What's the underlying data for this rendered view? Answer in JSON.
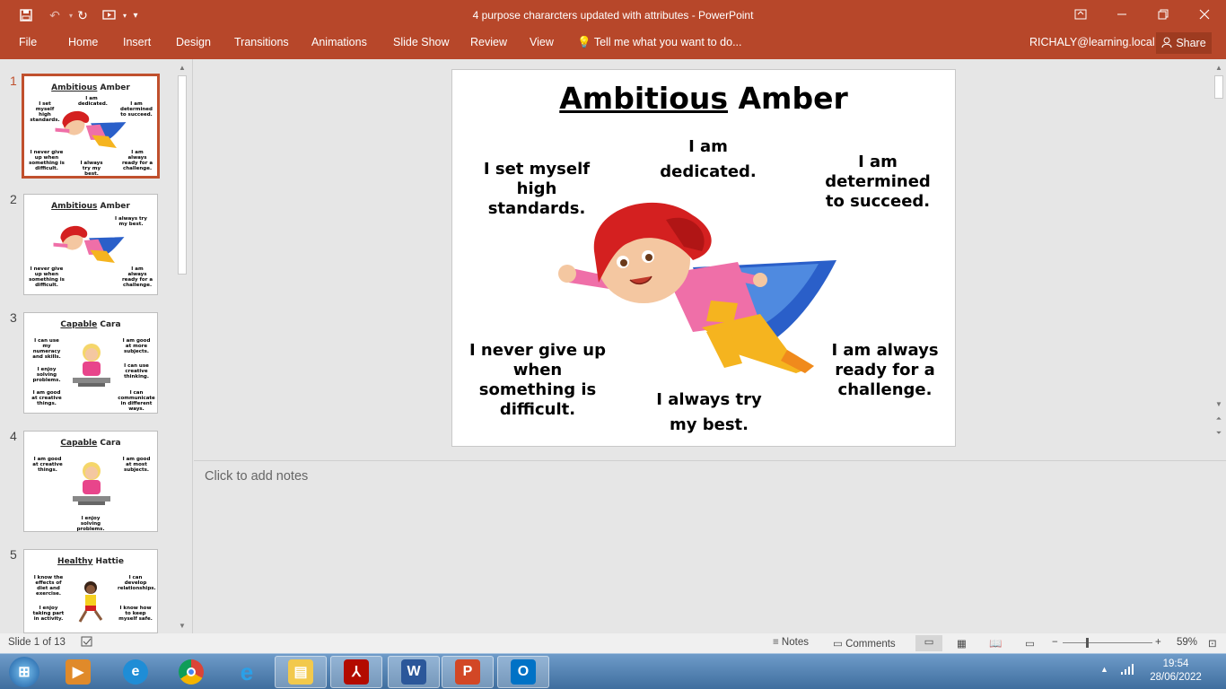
{
  "app": {
    "title": "4 purpose chararcters updated with attributes - PowerPoint",
    "user": "RICHALY@learning.local",
    "share_label": "Share",
    "accent": "#b7472a"
  },
  "ribbon": {
    "tabs": [
      "File",
      "Home",
      "Insert",
      "Design",
      "Transitions",
      "Animations",
      "Slide Show",
      "Review",
      "View"
    ],
    "tell_me": "Tell me what you want to do..."
  },
  "thumbnails": [
    {
      "number": "1",
      "title_u": "Ambitious",
      "title_rest": "Amber",
      "texts": [
        "I set myself high standards.",
        "I am dedicated.",
        "I am determined to succeed.",
        "I never give up when something is difficult.",
        "I always try my best.",
        "I am always ready for a challenge."
      ]
    },
    {
      "number": "2",
      "title_u": "Ambitious",
      "title_rest": "Amber",
      "texts": [
        "I always try my best.",
        "I never give up when something is difficult.",
        "I am always ready for a challenge."
      ]
    },
    {
      "number": "3",
      "title_u": "Capable",
      "title_rest": "Cara",
      "texts": [
        "I can use my numeracy and skills.",
        "I am good at more subjects.",
        "I enjoy solving problems.",
        "I can use creative thinking.",
        "I am good at creative things.",
        "I can communicate in different ways."
      ]
    },
    {
      "number": "4",
      "title_u": "Capable",
      "title_rest": "Cara",
      "texts": [
        "I am good at creative things.",
        "I am good at most subjects.",
        "I enjoy solving problems."
      ]
    },
    {
      "number": "5",
      "title_u": "Healthy",
      "title_rest": "Hattie",
      "texts": [
        "I know the effects of diet and exercise.",
        "I can develop relationships.",
        "I enjoy taking part in activity.",
        "I know how to keep myself safe."
      ]
    }
  ],
  "slide": {
    "title_underlined": "Ambitious",
    "title_rest": " Amber",
    "statements": {
      "set_myself": "I set myself high standards.",
      "dedicated": "I am dedicated.",
      "determined": "I am determined to succeed.",
      "never_give_up": "I never give up when something is difficult.",
      "try_best": "I always try my best.",
      "ready_challenge": "I am always ready for a challenge."
    }
  },
  "notes": {
    "placeholder": "Click to add notes"
  },
  "status": {
    "slide_info": "Slide 1 of 13",
    "notes_label": "Notes",
    "comments_label": "Comments",
    "zoom": "59%"
  },
  "taskbar": {
    "time": "19:54",
    "date": "28/06/2022",
    "apps": [
      "start-orb",
      "media-player",
      "edge",
      "chrome",
      "internet-explorer",
      "file-explorer",
      "acrobat",
      "word",
      "powerpoint",
      "outlook"
    ]
  }
}
